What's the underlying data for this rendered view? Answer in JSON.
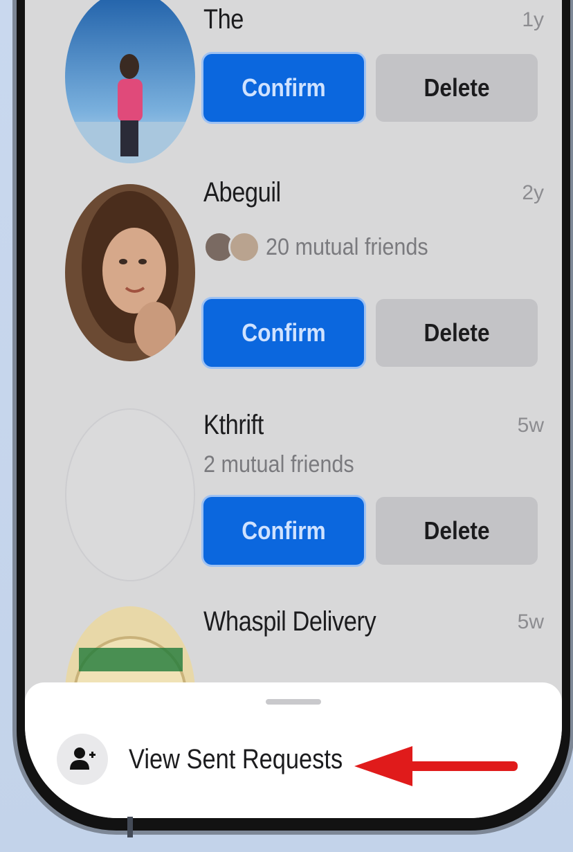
{
  "requests": [
    {
      "name": "The",
      "time": "1y",
      "mutual": "",
      "confirm_label": "Confirm",
      "delete_label": "Delete"
    },
    {
      "name": "Abeguil",
      "time": "2y",
      "mutual": "20 mutual friends",
      "confirm_label": "Confirm",
      "delete_label": "Delete"
    },
    {
      "name": "Kthrift",
      "time": "5w",
      "mutual": "2 mutual friends",
      "confirm_label": "Confirm",
      "delete_label": "Delete"
    },
    {
      "name": "Whaspil Delivery",
      "time": "5w"
    }
  ],
  "bottom_sheet": {
    "view_sent_label": "View Sent Requests",
    "icon": "add-person-icon"
  },
  "annotation": {
    "arrow_color": "#e01b1b"
  },
  "colors": {
    "confirm_bg": "#0b67de",
    "delete_bg": "#c3c3c6",
    "screen_bg": "#d8d8d9"
  }
}
